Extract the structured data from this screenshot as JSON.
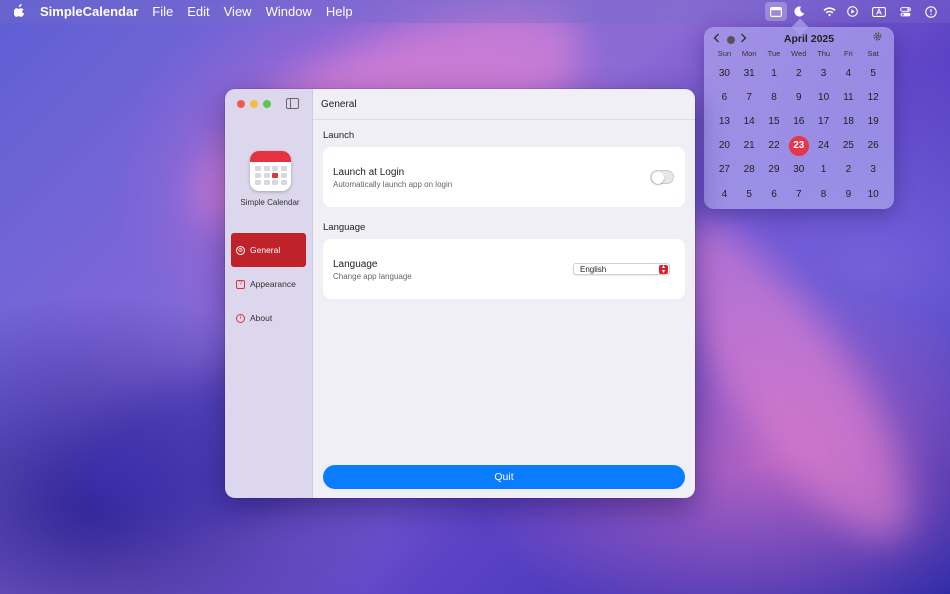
{
  "menubar": {
    "apple_icon": "apple-logo-icon",
    "app_name": "SimpleCalendar",
    "menus": [
      "File",
      "Edit",
      "View",
      "Window",
      "Help"
    ],
    "status_icons": [
      "calendar-icon",
      "moon-icon",
      "wifi-icon",
      "play-icon",
      "text-input-icon",
      "control-center-icon",
      "clock-icon"
    ]
  },
  "calendar_popover": {
    "month_label": "April 2025",
    "weekdays": [
      "Sun",
      "Mon",
      "Tue",
      "Wed",
      "Thu",
      "Fri",
      "Sat"
    ],
    "days": [
      "30",
      "31",
      "1",
      "2",
      "3",
      "4",
      "5",
      "6",
      "7",
      "8",
      "9",
      "10",
      "11",
      "12",
      "13",
      "14",
      "15",
      "16",
      "17",
      "18",
      "19",
      "20",
      "21",
      "22",
      "23",
      "24",
      "25",
      "26",
      "27",
      "28",
      "29",
      "30",
      "1",
      "2",
      "3",
      "4",
      "5",
      "6",
      "7",
      "8",
      "9",
      "10"
    ],
    "today": "23",
    "today_color": "#e5364b"
  },
  "window": {
    "app_name": "Simple Calendar",
    "nav": {
      "general": "General",
      "appearance": "Appearance",
      "about": "About"
    },
    "page_title": "General",
    "launch_section": {
      "label": "Launch",
      "title": "Launch at Login",
      "subtitle": "Automatically launch app on login",
      "enabled": false
    },
    "language_section": {
      "label": "Language",
      "title": "Language",
      "subtitle": "Change app language",
      "selected": "English"
    },
    "quit_label": "Quit",
    "accent_color": "#c0222a",
    "button_color": "#0a7cff"
  }
}
